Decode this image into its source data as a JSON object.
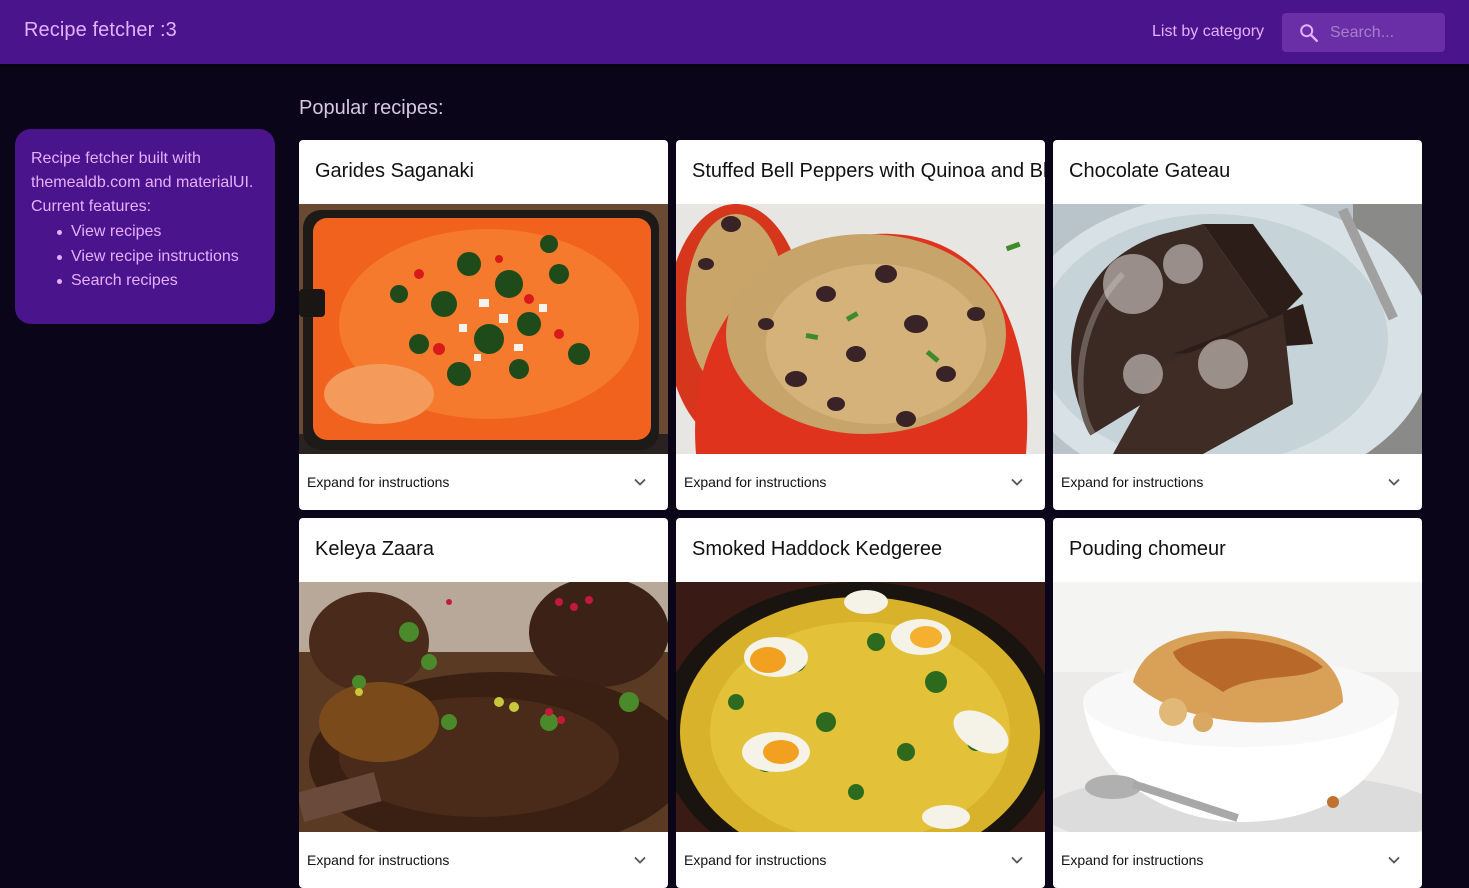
{
  "appbar": {
    "title": "Recipe fetcher :3",
    "nav_link": "List by category",
    "search_placeholder": "Search...",
    "search_value": "",
    "search_icon": "search-icon",
    "background": "#4a148c",
    "accent": "#e6b0ff"
  },
  "info": {
    "line1": "Recipe fetcher built with",
    "line2": "themealdb.com and materialUI.",
    "line3": "Current features:",
    "features": [
      "View recipes",
      "View recipe instructions",
      "Search recipes"
    ]
  },
  "main": {
    "section_title": "Popular recipes:",
    "expand_label": "Expand for instructions",
    "expand_icon": "chevron-down-icon",
    "recipes": [
      {
        "title": "Garides Saganaki",
        "image": "garides-saganaki-photo"
      },
      {
        "title": "Stuffed Bell Peppers with Quinoa and Black Beans",
        "image": "stuffed-bell-peppers-photo"
      },
      {
        "title": "Chocolate Gateau",
        "image": "chocolate-gateau-photo"
      },
      {
        "title": "Keleya Zaara",
        "image": "keleya-zaara-photo"
      },
      {
        "title": "Smoked Haddock Kedgeree",
        "image": "smoked-haddock-kedgeree-photo"
      },
      {
        "title": "Pouding chomeur",
        "image": "pouding-chomeur-photo"
      }
    ]
  }
}
